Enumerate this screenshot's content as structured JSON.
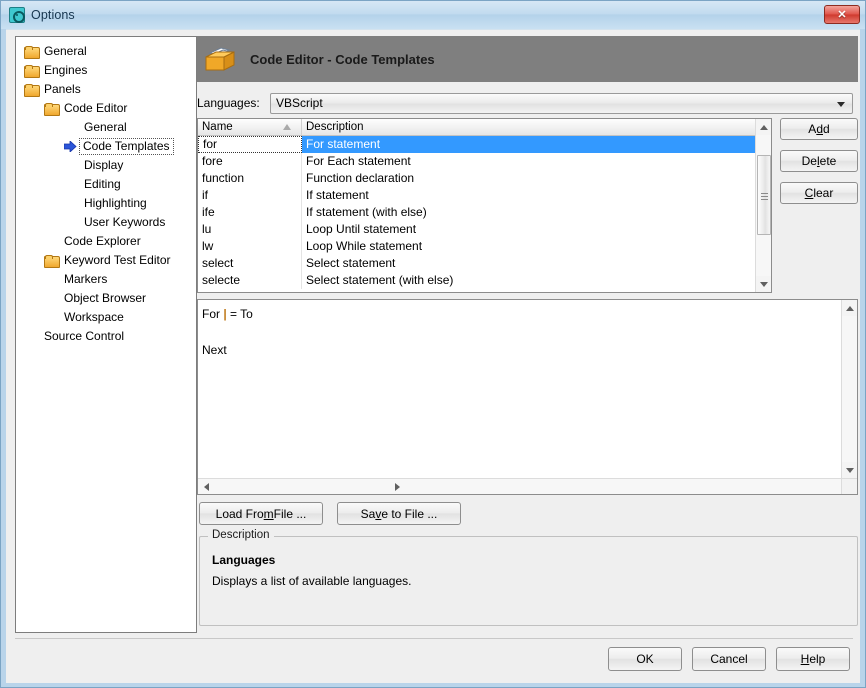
{
  "window": {
    "title": "Options",
    "icon": "options-target-icon",
    "close_label": "✕"
  },
  "tree": {
    "items": [
      {
        "label": "General",
        "indent": 0,
        "icon": "folder-icon",
        "selected": false
      },
      {
        "label": "Engines",
        "indent": 0,
        "icon": "folder-icon",
        "selected": false
      },
      {
        "label": "Panels",
        "indent": 0,
        "icon": "folder-icon",
        "selected": false
      },
      {
        "label": "Code Editor",
        "indent": 1,
        "icon": "folder-icon",
        "selected": false
      },
      {
        "label": "General",
        "indent": 2,
        "icon": "none",
        "selected": false
      },
      {
        "label": "Code Templates",
        "indent": 2,
        "icon": "arrow-icon",
        "selected": true
      },
      {
        "label": "Display",
        "indent": 2,
        "icon": "none",
        "selected": false
      },
      {
        "label": "Editing",
        "indent": 2,
        "icon": "none",
        "selected": false
      },
      {
        "label": "Highlighting",
        "indent": 2,
        "icon": "none",
        "selected": false
      },
      {
        "label": "User Keywords",
        "indent": 2,
        "icon": "none",
        "selected": false
      },
      {
        "label": "Code Explorer",
        "indent": 1,
        "icon": "none",
        "selected": false
      },
      {
        "label": "Keyword Test Editor",
        "indent": 1,
        "icon": "folder-icon",
        "selected": false
      },
      {
        "label": "Markers",
        "indent": 1,
        "icon": "none",
        "selected": false
      },
      {
        "label": "Object Browser",
        "indent": 1,
        "icon": "none",
        "selected": false
      },
      {
        "label": "Workspace",
        "indent": 1,
        "icon": "none",
        "selected": false
      },
      {
        "label": "Source Control",
        "indent": 0,
        "icon": "none",
        "selected": false
      }
    ]
  },
  "page": {
    "header_title": "Code Editor - Code Templates",
    "header_icon": "card-box-icon",
    "header_bg": "#7f7f7f"
  },
  "languages": {
    "label": "Languages:",
    "selected": "VBScript"
  },
  "grid": {
    "columns": [
      {
        "key": "name",
        "label": "Name",
        "sort": "ascending"
      },
      {
        "key": "description",
        "label": "Description",
        "sort": "none"
      }
    ],
    "rows": [
      {
        "name": "for",
        "description": "For statement",
        "selected": true
      },
      {
        "name": "fore",
        "description": "For Each statement",
        "selected": false
      },
      {
        "name": "function",
        "description": "Function declaration",
        "selected": false
      },
      {
        "name": "if",
        "description": "If statement",
        "selected": false
      },
      {
        "name": "ife",
        "description": "If statement (with else)",
        "selected": false
      },
      {
        "name": "lu",
        "description": "Loop Until statement",
        "selected": false
      },
      {
        "name": "lw",
        "description": "Loop While statement",
        "selected": false
      },
      {
        "name": "select",
        "description": "Select statement",
        "selected": false
      },
      {
        "name": "selecte",
        "description": "Select statement (with else)",
        "selected": false
      }
    ],
    "selection_color": "#3399ff"
  },
  "side_buttons": [
    {
      "label": "Add",
      "accel": "d",
      "name": "add-button"
    },
    {
      "label": "Delete",
      "accel": "l",
      "name": "delete-button"
    },
    {
      "label": "Clear",
      "accel": "C",
      "name": "clear-button"
    }
  ],
  "preview": {
    "line1_before": "For ",
    "caret": "|",
    "line1_after": " = To",
    "line2": "Next"
  },
  "file_buttons": [
    {
      "label_before": "Load Fro",
      "accel": "m",
      "label_after": " File ...",
      "name": "load-from-file-button"
    },
    {
      "label_before": "Sa",
      "accel": "v",
      "label_after": "e to File ...",
      "name": "save-to-file-button"
    }
  ],
  "description": {
    "group_title": "Description",
    "heading": "Languages",
    "text": "Displays a list of available languages."
  },
  "footer": {
    "ok": "OK",
    "cancel": "Cancel",
    "help_before": "",
    "help_accel": "H",
    "help_after": "elp"
  }
}
